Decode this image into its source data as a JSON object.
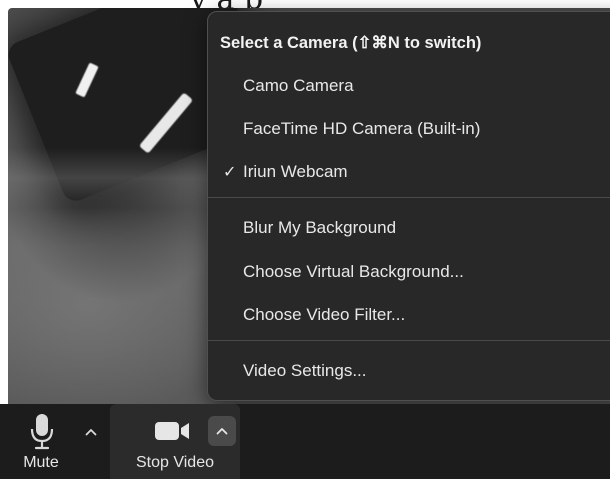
{
  "background": {
    "partial_text": "y a p"
  },
  "camera_menu": {
    "header": "Select a Camera (⇧⌘N to switch)",
    "cameras": [
      {
        "label": "Camo Camera",
        "selected": false
      },
      {
        "label": "FaceTime HD Camera (Built-in)",
        "selected": false
      },
      {
        "label": "Iriun Webcam",
        "selected": true
      }
    ],
    "check_glyph": "✓",
    "effects": [
      {
        "label": "Blur My Background"
      },
      {
        "label": "Choose Virtual Background..."
      },
      {
        "label": "Choose Video Filter..."
      }
    ],
    "settings": {
      "label": "Video Settings..."
    }
  },
  "toolbar": {
    "mute": {
      "label": "Mute",
      "icon": "microphone-icon",
      "caret_icon": "chevron-up-icon"
    },
    "video": {
      "label": "Stop Video",
      "icon": "video-camera-icon",
      "caret_icon": "chevron-up-icon"
    }
  },
  "colors": {
    "menu_background": "#282828",
    "toolbar_background": "#1c1c1c",
    "menu_text": "#e8e8e8"
  }
}
